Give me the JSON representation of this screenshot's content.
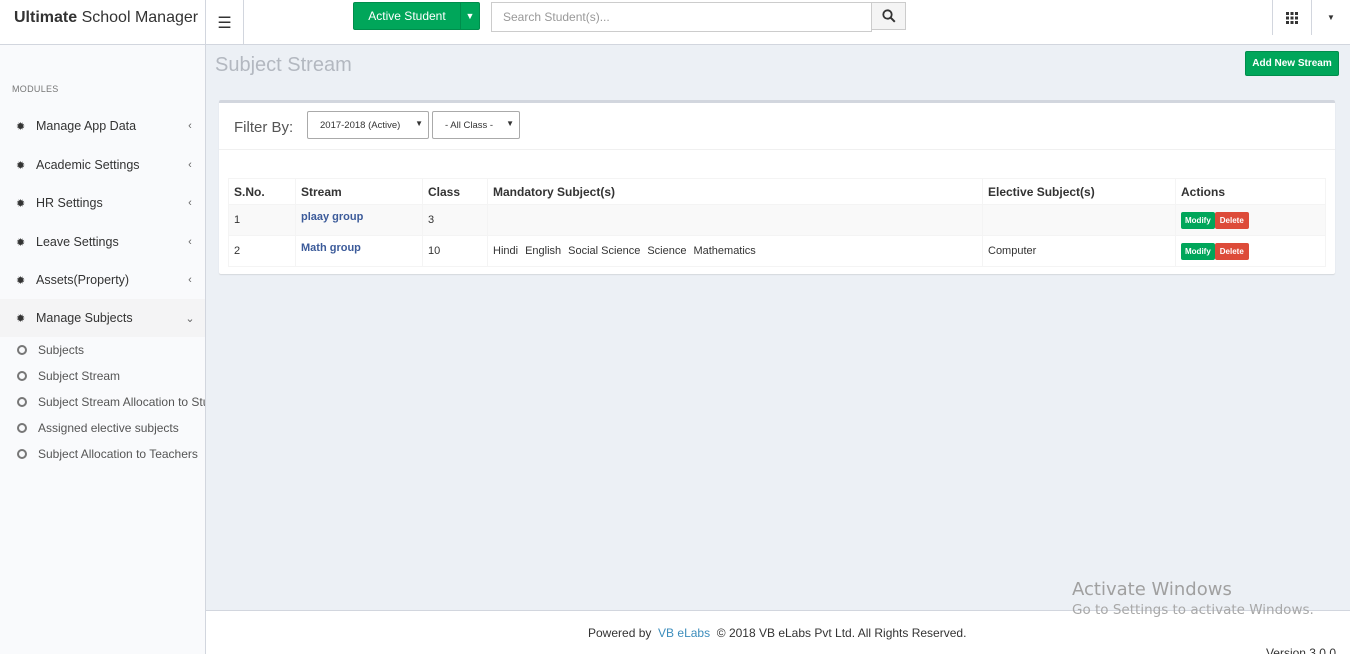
{
  "brand": {
    "bold": "Ultimate",
    "rest": "School Manager"
  },
  "topbar": {
    "active_student_label": "Active Student",
    "search_placeholder": "Search Student(s)..."
  },
  "sidebar": {
    "header": "MODULES",
    "items": [
      {
        "label": "Manage App Data"
      },
      {
        "label": "Academic Settings"
      },
      {
        "label": "HR Settings"
      },
      {
        "label": "Leave Settings"
      },
      {
        "label": "Assets(Property)"
      },
      {
        "label": "Manage Subjects"
      }
    ],
    "subitems": [
      {
        "label": "Subjects"
      },
      {
        "label": "Subject Stream"
      },
      {
        "label": "Subject Stream Allocation to Stu"
      },
      {
        "label": "Assigned elective subjects"
      },
      {
        "label": "Subject Allocation to Teachers"
      }
    ]
  },
  "main": {
    "title": "Subject Stream",
    "add_button": "Add New Stream",
    "filter_label": "Filter By:",
    "session_select": "2017-2018 (Active)",
    "class_select": "- All Class -",
    "table": {
      "headers": [
        "S.No.",
        "Stream",
        "Class",
        "Mandatory Subject(s)",
        "Elective Subject(s)",
        "Actions"
      ],
      "rows": [
        {
          "sno": "1",
          "stream": "plaay group",
          "class": "3",
          "mandatory": [],
          "elective": ""
        },
        {
          "sno": "2",
          "stream": "Math group",
          "class": "10",
          "mandatory": [
            "Hindi",
            "English",
            "Social Science",
            "Science",
            "Mathematics"
          ],
          "elective": "Computer"
        }
      ],
      "modify_label": "Modify",
      "delete_label": "Delete"
    }
  },
  "footer": {
    "powered_by": "Powered by",
    "company_link": "VB eLabs",
    "copyright": "© 2018 VB eLabs Pvt Ltd. All Rights Reserved.",
    "version": "Version 3.0.0"
  },
  "watermark": {
    "line1": "Activate Windows",
    "line2": "Go to Settings to activate Windows."
  },
  "colors": {
    "success": "#00a65a",
    "danger": "#dd4b39",
    "link": "#3c5b9a"
  }
}
